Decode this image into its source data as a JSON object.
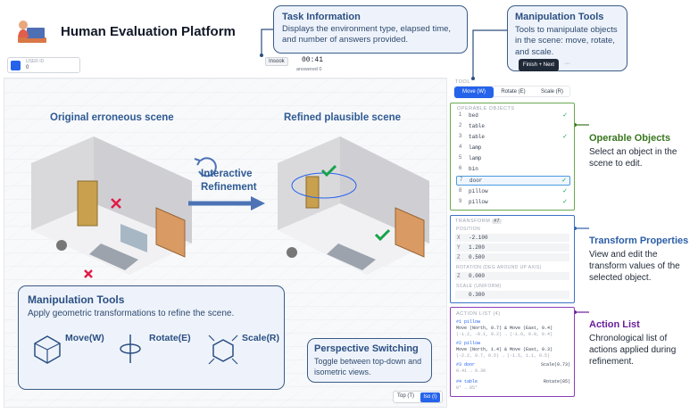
{
  "header": {
    "title": "Human Evaluation Platform",
    "user_label": "USER ID",
    "user_value": "0"
  },
  "status": {
    "environment": "Insook",
    "timer": "00:41",
    "answered": "answered 0",
    "finish_label": "Finish + Next",
    "more_label": "···"
  },
  "callouts": {
    "task_title": "Task Information",
    "task_desc": "Displays the environment type, elapsed time, and number of answers provided.",
    "manip_top_title": "Manipulation Tools",
    "manip_top_desc": "Tools to manipulate objects in the scene: move, rotate, and scale.",
    "manip_bottom_title": "Manipulation Tools",
    "manip_bottom_desc": "Apply geometric transformations to refine the scene.",
    "persp_title": "Perspective Switching",
    "persp_desc": "Toggle between top-down and isometric views."
  },
  "canvas": {
    "scene1_label": "Original erroneous scene",
    "scene2_label": "Refined plausible scene",
    "refine_line1": "Interactive",
    "refine_line2": "Refinement",
    "tool_move": "Move(W)",
    "tool_rotate": "Rotate(E)",
    "tool_scale": "Scale(R)",
    "view_top": "Top (T)",
    "view_iso": "Iso (I)"
  },
  "panel": {
    "tool_label": "TOOL",
    "tabs": [
      {
        "label": "Move (W)",
        "active": true
      },
      {
        "label": "Rotate (E)",
        "active": false
      },
      {
        "label": "Scale (R)",
        "active": false
      }
    ],
    "objects_label": "OPERABLE OBJECTS",
    "objects": [
      {
        "num": "1",
        "name": "bed",
        "checked": true,
        "selected": false
      },
      {
        "num": "2",
        "name": "table",
        "checked": false,
        "selected": false
      },
      {
        "num": "3",
        "name": "table",
        "checked": true,
        "selected": false
      },
      {
        "num": "4",
        "name": "lamp",
        "checked": false,
        "selected": false
      },
      {
        "num": "5",
        "name": "lamp",
        "checked": false,
        "selected": false
      },
      {
        "num": "6",
        "name": "bin",
        "checked": false,
        "selected": false
      },
      {
        "num": "7",
        "name": "door",
        "checked": true,
        "selected": true
      },
      {
        "num": "8",
        "name": "pillow",
        "checked": true,
        "selected": false
      },
      {
        "num": "9",
        "name": "pillow",
        "checked": true,
        "selected": false
      }
    ],
    "transform_label": "TRANSFORM",
    "transform_badge": "#7",
    "position_label": "POSITION",
    "pos_x": "-2.100",
    "pos_y": "1.200",
    "pos_z": "0.500",
    "rotation_label": "ROTATION (DEG AROUND UP AXIS)",
    "rot_z": "0.000",
    "scale_label": "SCALE (UNIFORM)",
    "scale_val": "0.300",
    "action_label": "ACTION LIST (4)",
    "actions": [
      {
        "title": "#1 pillow",
        "line": "Move (North, 0.7) & Move (East, 0.4)",
        "sub": "(-1.2, -0.1, 0.2) → (-1.6, 0.0, 0.4)",
        "right": ""
      },
      {
        "title": "#2 pillow",
        "line": "Move (North, 1.4) & Move (East, 0.3)",
        "sub": "(-2.2, 0.7, 0.5) → (-1.5, 1.1, 0.5)",
        "right": ""
      },
      {
        "title": "#3 door",
        "line": "",
        "sub": "0.41 → 0.30",
        "right": "Scale(0.73)"
      },
      {
        "title": "#4 table",
        "line": "",
        "sub": "0° → 85°",
        "right": "Rotate(85)"
      }
    ]
  },
  "annotations": {
    "objects_title": "Operable Objects",
    "objects_desc": "Select an object in the scene to edit.",
    "transform_title": "Transform Properties",
    "transform_desc": "View and edit the transform values of the selected object.",
    "actions_title": "Action List",
    "actions_desc": "Chronological list of actions applied during refinement."
  },
  "colors": {
    "accent": "#2563eb",
    "callout_border": "#3b5b86",
    "objects_border": "#6aa84f",
    "transform_border": "#3d73c6",
    "actions_border": "#8a3fb8"
  }
}
